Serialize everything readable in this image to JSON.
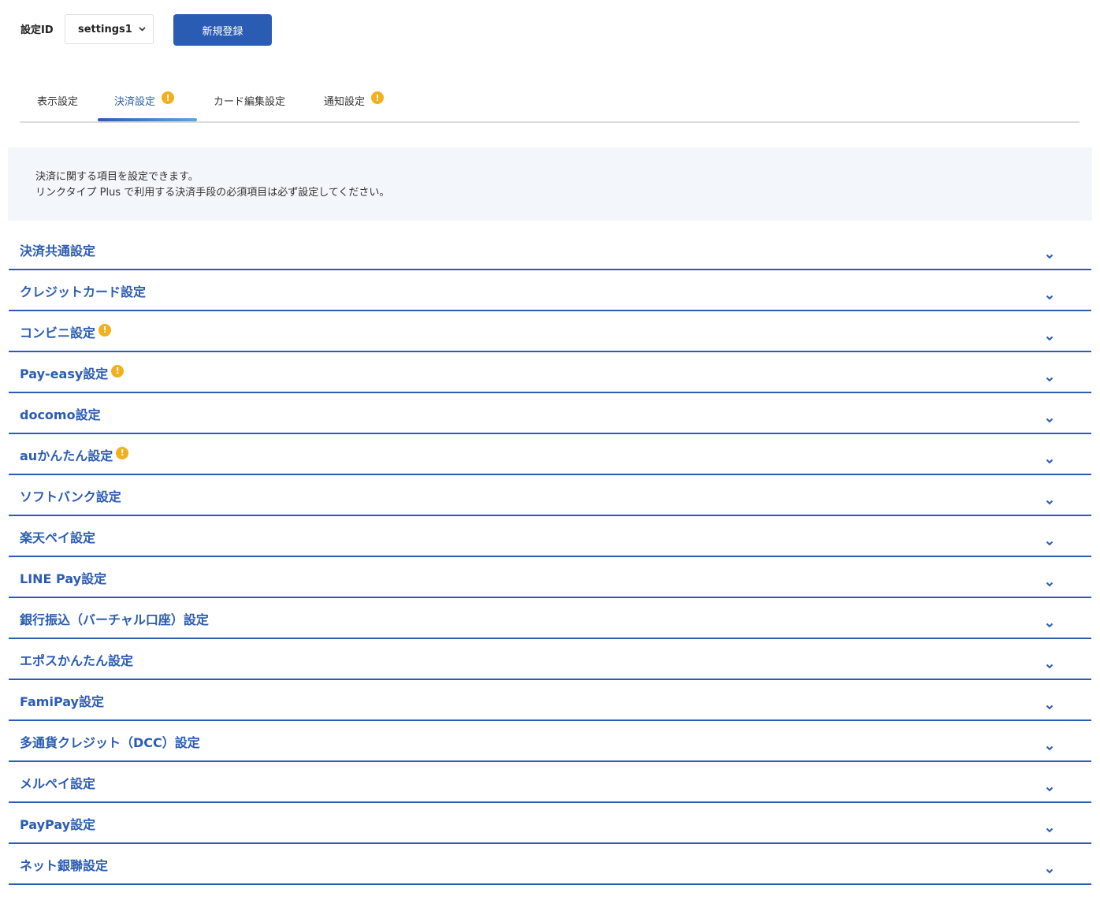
{
  "header": {
    "setting_id_label": "設定ID",
    "setting_id_value": "settings1",
    "register_button": "新規登録"
  },
  "tabs": [
    {
      "label": "表示設定",
      "active": false,
      "warning": false
    },
    {
      "label": "決済設定",
      "active": true,
      "warning": true
    },
    {
      "label": "カード編集設定",
      "active": false,
      "warning": false
    },
    {
      "label": "通知設定",
      "active": false,
      "warning": true
    }
  ],
  "info": {
    "line1": "決済に関する項目を設定できます。",
    "line2": "リンクタイプ Plus で利用する決済手段の必須項目は必ず設定してください。"
  },
  "sections": [
    {
      "label": "決済共通設定",
      "warning": false
    },
    {
      "label": "クレジットカード設定",
      "warning": false
    },
    {
      "label": "コンビニ設定",
      "warning": true
    },
    {
      "label": "Pay-easy設定",
      "warning": true
    },
    {
      "label": "docomo設定",
      "warning": false
    },
    {
      "label": "auかんたん設定",
      "warning": true
    },
    {
      "label": "ソフトバンク設定",
      "warning": false
    },
    {
      "label": "楽天ペイ設定",
      "warning": false
    },
    {
      "label": "LINE Pay設定",
      "warning": false
    },
    {
      "label": "銀行振込（バーチャル口座）設定",
      "warning": false
    },
    {
      "label": "エポスかんたん設定",
      "warning": false
    },
    {
      "label": "FamiPay設定",
      "warning": false
    },
    {
      "label": "多通貨クレジット（DCC）設定",
      "warning": false
    },
    {
      "label": "メルペイ設定",
      "warning": false
    },
    {
      "label": "PayPay設定",
      "warning": false
    },
    {
      "label": "ネット銀聯設定",
      "warning": false
    }
  ],
  "warning_glyph": "!",
  "colors": {
    "accent": "#2b5cb3",
    "warning": "#f2b01e",
    "info_bg": "#f3f6fb"
  }
}
